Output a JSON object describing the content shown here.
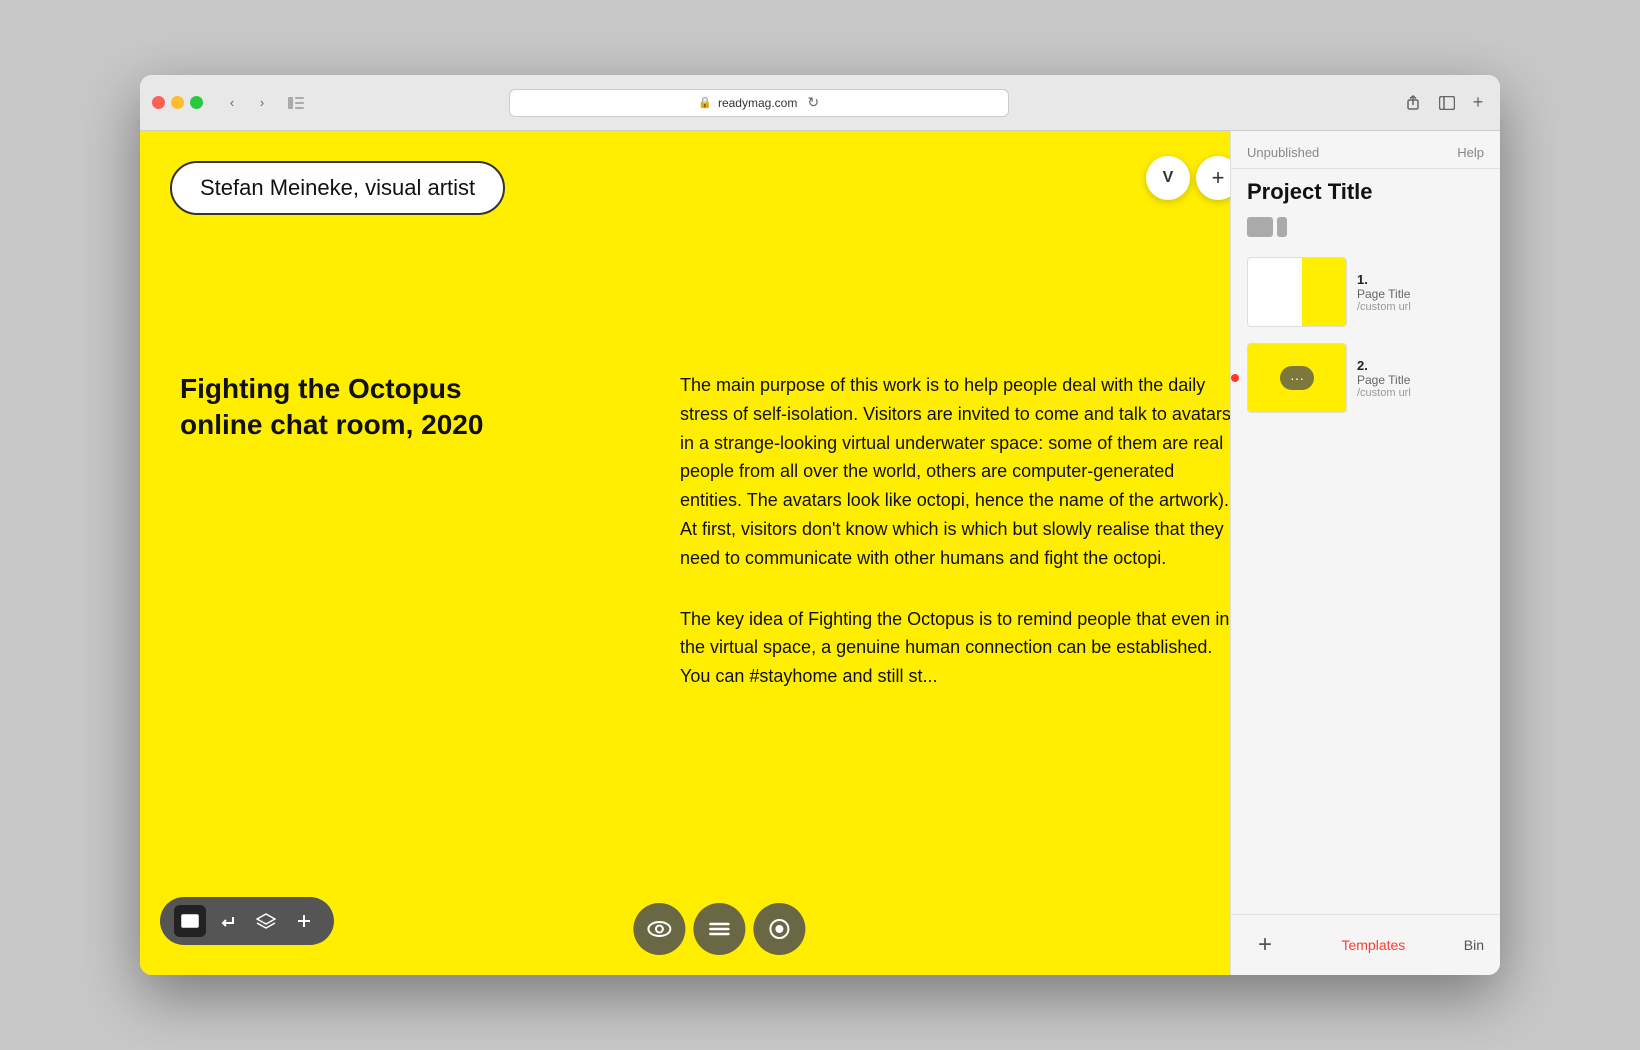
{
  "browser": {
    "url": "readymag.com",
    "add_tab_label": "+"
  },
  "canvas": {
    "artist_name": "Stefan Meineke, visual artist",
    "avatar_label": "V",
    "plus_label": "+",
    "artwork_title_line1": "Fighting the Octopus",
    "artwork_title_line2": "online chat room, 2020",
    "main_text_1": "The main purpose of this work is to help people deal with the daily stress of self-isolation. Visitors are invited to come and talk to avatars in a strange-looking virtual underwater space: some of them are real people from all over the world, others are computer-generated entities. The avatars look like octopi, hence the name of the artwork). At first, visitors don't know which is which but slowly realise that they need to communicate with other humans and fight the octopi.",
    "main_text_2": "The key idea of Fighting the Octopus is to remind people that even in the virtual space, a genuine human connection can be established. You can #stayhome and still st..."
  },
  "toolbar": {
    "rectangle_icon": "▬",
    "enter_icon": "↵",
    "layers_icon": "⊕",
    "add_icon": "+"
  },
  "overlay": {
    "eye_icon": "👁",
    "menu_icon": "≡",
    "circle_icon": "◉"
  },
  "sidebar": {
    "status": "Unpublished",
    "help": "Help",
    "project_title": "Project Title",
    "pages": [
      {
        "number": "1.",
        "name": "Page Title",
        "url": "/custom url",
        "has_indicator": false,
        "has_menu": false
      },
      {
        "number": "2.",
        "name": "Page Title",
        "url": "/custom url",
        "has_indicator": true,
        "has_menu": true
      }
    ],
    "footer": {
      "add_label": "+",
      "templates_label": "Templates",
      "bin_label": "Bin"
    }
  }
}
